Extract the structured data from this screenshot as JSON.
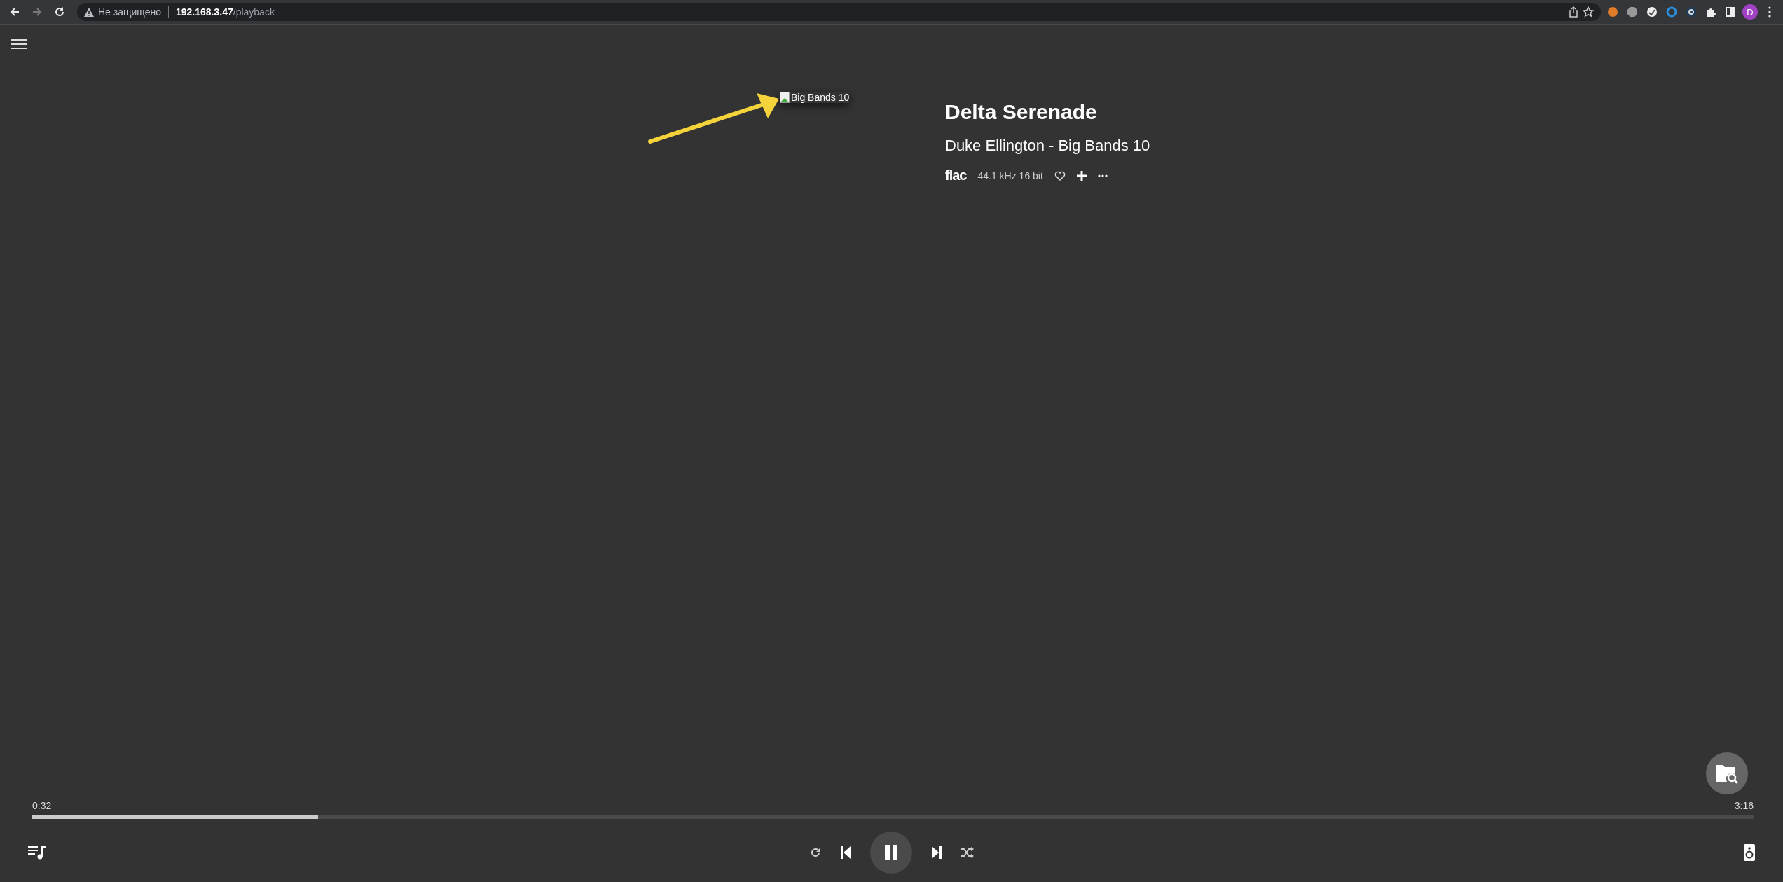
{
  "browser": {
    "nav_buttons": [
      {
        "kind": "back",
        "disabled": false
      },
      {
        "kind": "forward",
        "disabled": true
      },
      {
        "kind": "reload",
        "disabled": false
      }
    ],
    "security_label": "Не защищено",
    "url_host": "192.168.3.47",
    "url_path": "/playback",
    "profile_initial": "D"
  },
  "track": {
    "cover_alt": "Big Bands 10",
    "title": "Delta Serenade",
    "subtitle": "Duke Ellington - Big Bands 10",
    "format": "flac",
    "quality": "44.1 kHz 16 bit"
  },
  "progress": {
    "elapsed": "0:32",
    "duration": "3:16",
    "level": 0.166
  },
  "controls": {
    "repeat": {
      "on": false
    },
    "shuffle": {
      "on": false
    },
    "playing": true
  }
}
